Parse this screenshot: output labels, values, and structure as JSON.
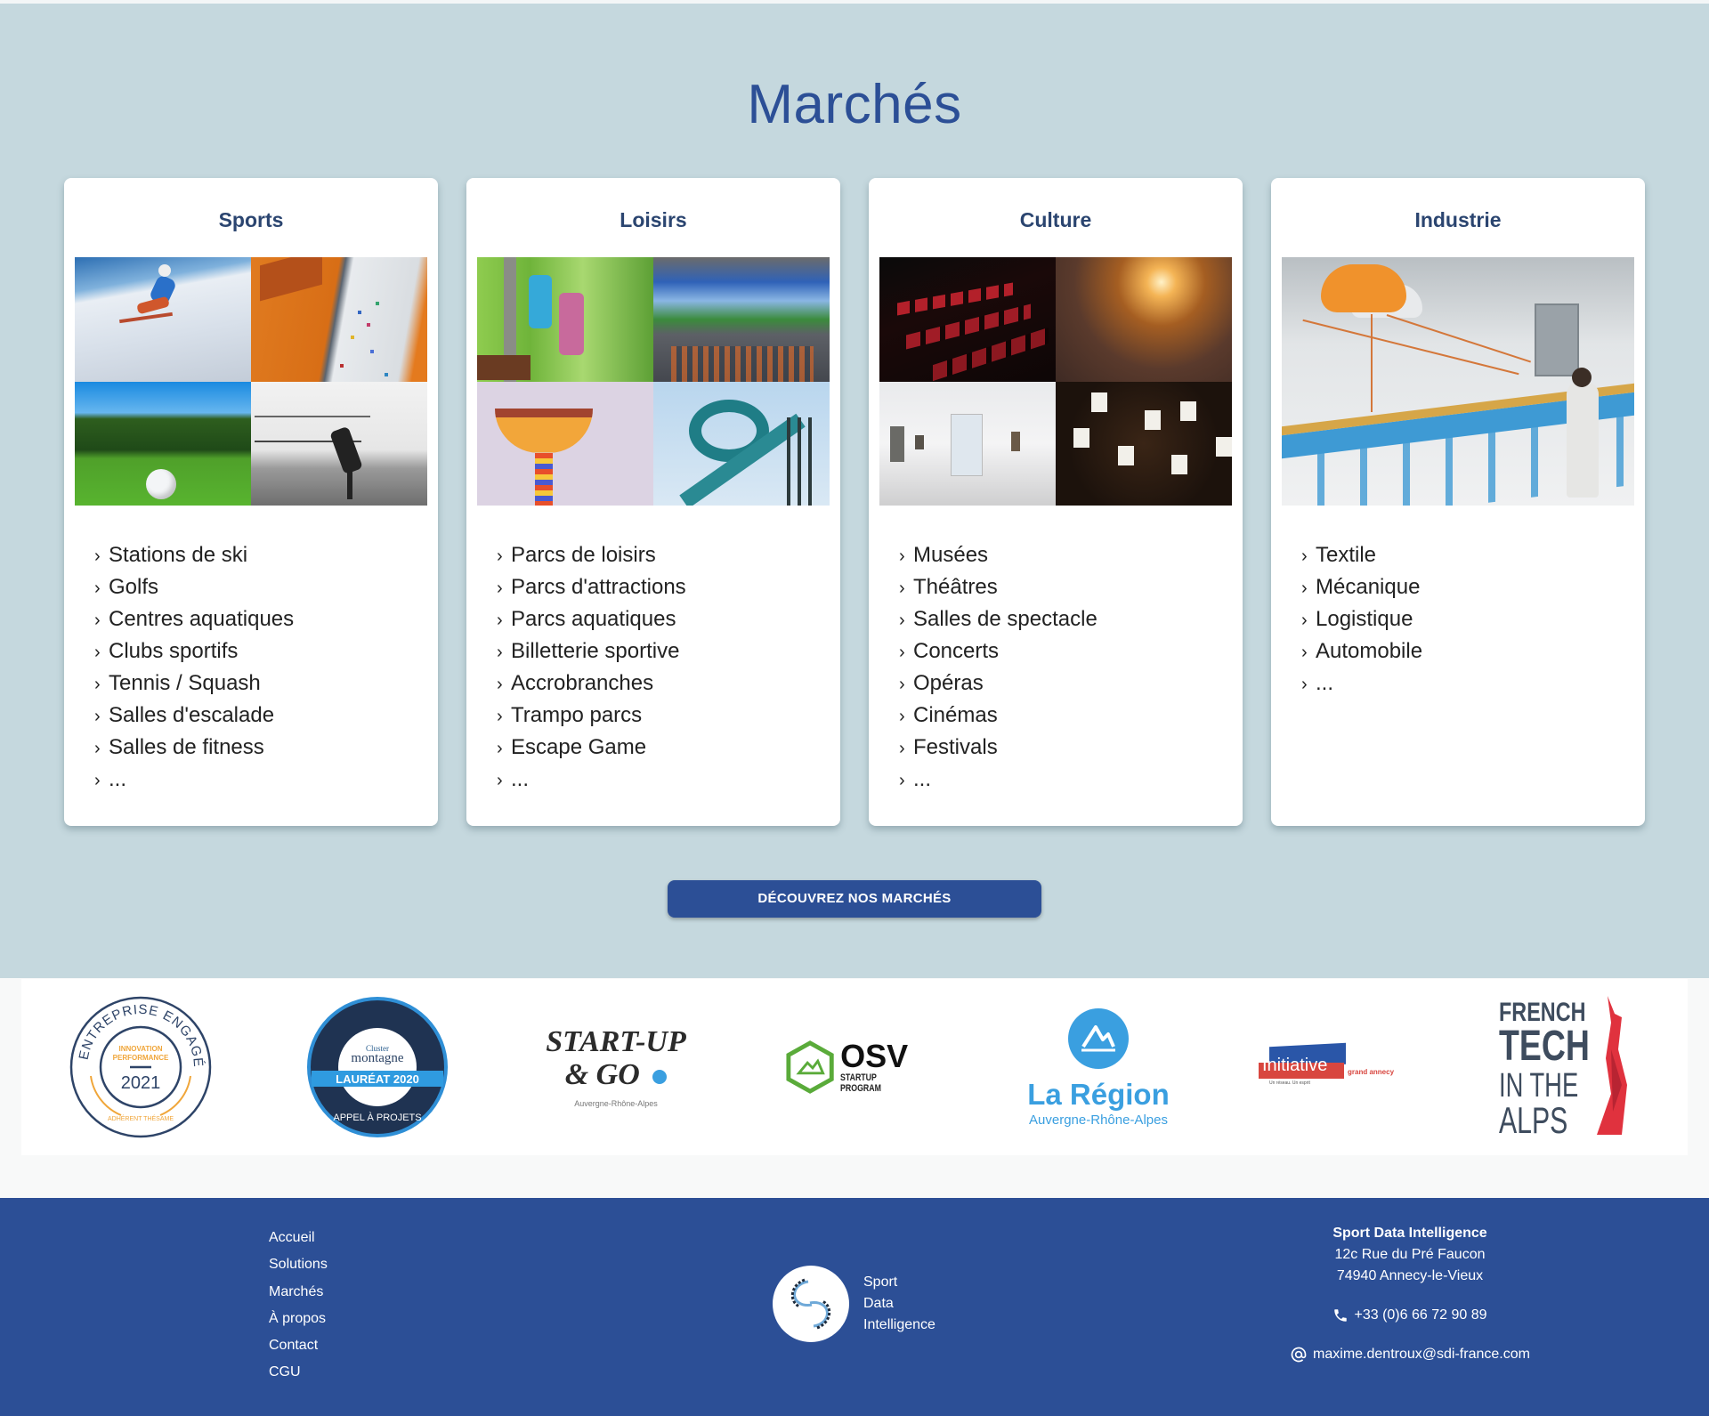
{
  "markets": {
    "title": "Marchés",
    "cards": [
      {
        "title": "Sports",
        "image_tiles": [
          "ski-photo",
          "climbing-wall-photo",
          "golf-ball-photo",
          "squash-player-photo"
        ],
        "items": [
          "Stations de ski",
          "Golfs",
          "Centres aquatiques",
          "Clubs sportifs",
          "Tennis / Squash",
          "Salles d'escalade",
          "Salles de fitness",
          "..."
        ]
      },
      {
        "title": "Loisirs",
        "image_tiles": [
          "accrobranche-photo",
          "stadium-photo",
          "chair-swing-ride-photo",
          "water-slide-photo"
        ],
        "items": [
          "Parcs de loisirs",
          "Parcs d'attractions",
          "Parcs aquatiques",
          "Billetterie sportive",
          "Accrobranches",
          "Trampo parcs",
          "Escape Game",
          "..."
        ]
      },
      {
        "title": "Culture",
        "image_tiles": [
          "cinema-seats-photo",
          "concert-crowd-photo",
          "museum-gallery-photo",
          "orchestra-photo"
        ],
        "items": [
          "Musées",
          "Théâtres",
          "Salles de spectacle",
          "Concerts",
          "Opéras",
          "Cinémas",
          "Festivals",
          "..."
        ]
      },
      {
        "title": "Industrie",
        "image_tiles": [
          "industry-4-0-production-line-illustration"
        ],
        "items": [
          "Textile",
          "Mécanique",
          "Logistique",
          "Automobile",
          "..."
        ]
      }
    ],
    "cta_label": "DÉCOUVREZ NOS MARCHÉS",
    "chevron": "›"
  },
  "partners": [
    {
      "name": "Entreprise Engagée",
      "line1": "ENTREPRISE ENGAGÉE",
      "line2": "INNOVATION",
      "line3": "PERFORMANCE",
      "year": "2021",
      "footer": "ADHÉRENT THÉSAME"
    },
    {
      "name": "Cluster Montagne",
      "top": "Cluster",
      "brand": "montagne",
      "band": "LAURÉAT 2020",
      "footer": "APPEL À PROJETS"
    },
    {
      "name": "Start-up & Go",
      "line1": "START-UP",
      "line2": "& GO",
      "sub": "Auvergne-Rhône-Alpes"
    },
    {
      "name": "OSV Startup Program",
      "brand": "OSV",
      "sub": "STARTUP PROGRAM"
    },
    {
      "name": "La Région",
      "brand": "La Région",
      "sub": "Auvergne-Rhône-Alpes"
    },
    {
      "name": "Initiative Grand Annecy",
      "brand": "Initiative",
      "sub": "grand annecy",
      "tagline": "Un réseau. Un esprit"
    },
    {
      "name": "French Tech in the Alps",
      "line1": "FRENCH",
      "line2": "TECH",
      "line3": "IN THE",
      "line4": "ALPS"
    }
  ],
  "footer": {
    "links": [
      "Accueil",
      "Solutions",
      "Marchés",
      "À propos",
      "Contact",
      "CGU"
    ],
    "brand": {
      "line1": "Sport",
      "line2": "Data",
      "line3": "Intelligence"
    },
    "contact": {
      "company": "Sport Data Intelligence",
      "address1": "12c Rue du Pré Faucon",
      "address2": "74940 Annecy-le-Vieux",
      "phone": "+33 (0)6 66 72 90 89",
      "email": "maxime.dentroux@sdi-france.com"
    }
  },
  "colors": {
    "brand_blue": "#2c4f96",
    "section_bg": "#c5d8de",
    "card_bg": "#ffffff"
  }
}
